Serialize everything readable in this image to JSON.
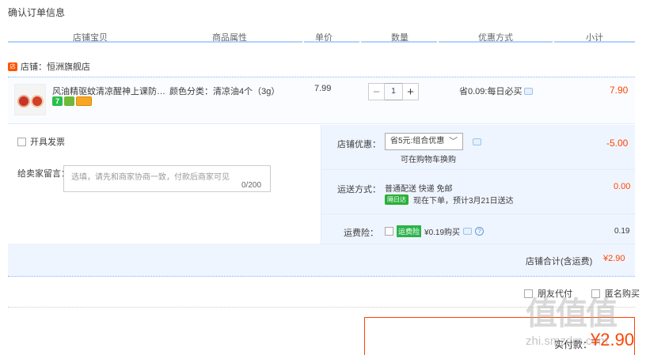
{
  "page_title": "确认订单信息",
  "columns": [
    "店铺宝贝",
    "商品属性",
    "单价",
    "数量",
    "优惠方式",
    "小计"
  ],
  "shop": {
    "badge": "店",
    "label": "店铺：恒洲旗舰店"
  },
  "item": {
    "title": "风油精驱蚊清凉醒神上课防困提...",
    "attribute": "颜色分类：清凉油4个（3g）",
    "unit_price": "7.99",
    "quantity": "1",
    "qty_minus": "−",
    "qty_plus": "+",
    "promo": "省0.09:每日必买",
    "line_total": "7.90",
    "icon_seven": "7"
  },
  "invoice_label": "开具发票",
  "message": {
    "label": "给卖家留言：",
    "placeholder": "选填，请先和商家协商一致，付款后商家可见",
    "count": "0/200"
  },
  "shop_discount": {
    "label": "店铺优惠：",
    "selected": "省5元:组合优惠",
    "caret": "﹀",
    "note": "可在购物车换购",
    "amount": "-5.00"
  },
  "shipping": {
    "label": "运送方式：",
    "method": "普通配送 快递 免邮",
    "badge": "隔日达",
    "eta": "现在下单，预计3月21日送达",
    "fee": "0.00"
  },
  "insurance": {
    "label": "运费险：",
    "badge": "运费险",
    "price": "¥0.19购买",
    "help": "?",
    "fee": "0.19"
  },
  "subtotal": {
    "label": "店铺合计(含运费)",
    "amount": "¥2.90"
  },
  "friend_pay": "朋友代付",
  "anon_buy": "匿名购买",
  "pay": {
    "label": "实付款：",
    "amount": "¥2.90"
  },
  "watermark": {
    "main": "值值值",
    "sub": "zhi.smzdm.com"
  },
  "colors": {
    "accent": "#ff4400",
    "divider": "#b2d1ff",
    "panel": "#eff5ff"
  }
}
